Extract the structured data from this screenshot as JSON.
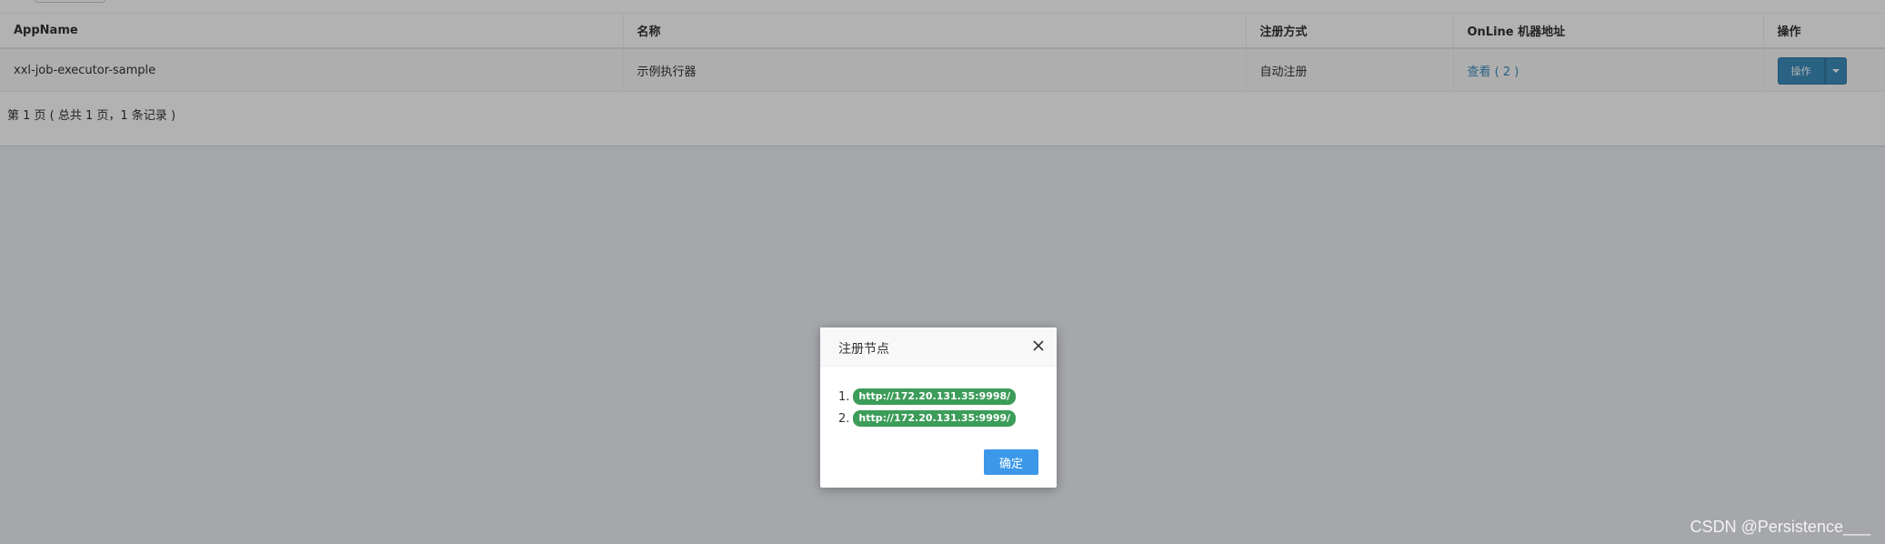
{
  "table": {
    "headers": [
      "AppName",
      "名称",
      "注册方式",
      "OnLine 机器地址",
      "操作"
    ],
    "rows": [
      {
        "appname": "xxl-job-executor-sample",
        "title": "示例执行器",
        "address_type": "自动注册",
        "online_link": "查看 ( 2 )",
        "op_label": "操作"
      }
    ]
  },
  "pager": {
    "text": "第 1 页 ( 总共 1 页，1 条记录 )"
  },
  "modal": {
    "title": "注册节点",
    "nodes": [
      {
        "index": "1.",
        "address": "http://172.20.131.35:9998/"
      },
      {
        "index": "2.",
        "address": "http://172.20.131.35:9999/"
      }
    ],
    "confirm_label": "确定"
  },
  "watermark": "CSDN @Persistence___",
  "colors": {
    "primary": "#3c8dbc",
    "badge_green": "#3c9c59",
    "confirm_blue": "#3c98e8"
  }
}
